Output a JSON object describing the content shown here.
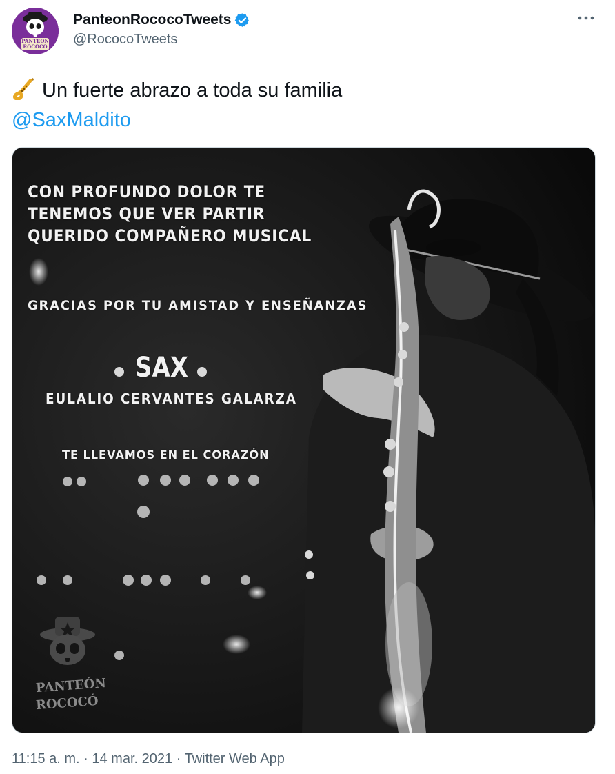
{
  "author": {
    "display_name": "PanteonRococoTweets",
    "handle": "@RococoTweets",
    "verified": true,
    "avatar_text": [
      "PANTEON",
      "ROCOCO"
    ]
  },
  "tweet": {
    "emoji": "saxophone-icon",
    "text": "Un fuerte abrazo a toda su familia",
    "mention": "@SaxMaldito"
  },
  "media": {
    "headline_lines": [
      "Con profundo dolor te",
      "tenemos que ver partir",
      "querido compañero musical"
    ],
    "gracias": "Gracias por tu amistad y enseñanzas",
    "sax": "SAX",
    "fullname": "Eulalio Cervantes Galarza",
    "corazon": "Te llevamos en el corazón",
    "logo_lines": [
      "PANTEÓN",
      "ROCOCÓ"
    ]
  },
  "meta": {
    "time": "11:15 a. m.",
    "separator": "·",
    "date": "14 mar. 2021",
    "source": "Twitter Web App"
  },
  "colors": {
    "link": "#1d9bf0",
    "secondary_text": "#536471",
    "avatar_bg": "#7a2e9a",
    "verified": "#1d9bf0"
  }
}
